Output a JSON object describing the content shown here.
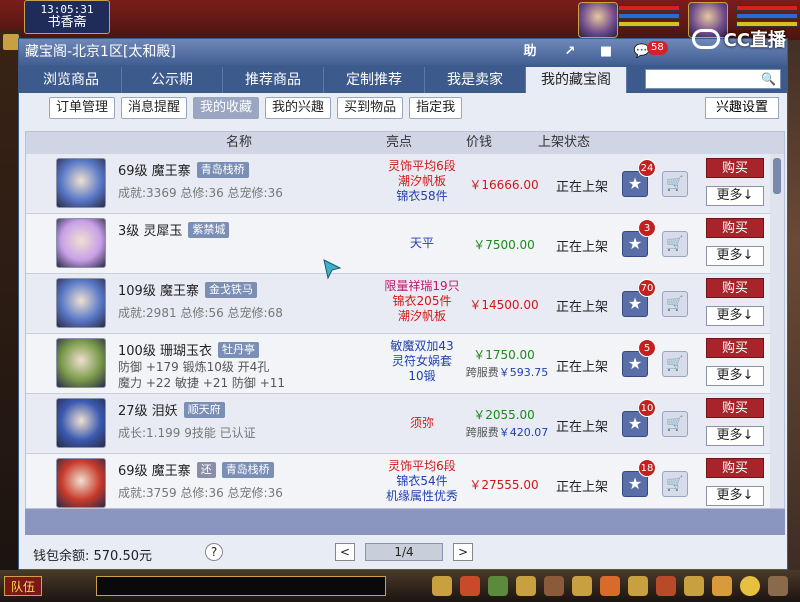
{
  "hud": {
    "clock": "13:05:31",
    "location": "书香斋",
    "stream_brand": "CC直播",
    "team_label": "队伍"
  },
  "window": {
    "title": "藏宝阁-北京1区[太和殿]",
    "title_buttons": [
      "助",
      "↗",
      "■",
      "💬"
    ],
    "notify_count": "58"
  },
  "tabs": [
    {
      "label": "浏览商品"
    },
    {
      "label": "公示期"
    },
    {
      "label": "推荐商品"
    },
    {
      "label": "定制推荐"
    },
    {
      "label": "我是卖家"
    },
    {
      "label": "我的藏宝阁"
    }
  ],
  "search": {
    "placeholder": ""
  },
  "subtabs": [
    {
      "label": "订单管理"
    },
    {
      "label": "消息提醒"
    },
    {
      "label": "我的收藏"
    },
    {
      "label": "我的兴趣"
    },
    {
      "label": "买到物品"
    },
    {
      "label": "指定我"
    }
  ],
  "interest_settings": "兴趣设置",
  "table": {
    "headers": [
      "名称",
      "亮点",
      "价钱",
      "上架状态"
    ],
    "rows": [
      {
        "level_name": "69级  魔王寨",
        "tag": "青岛栈桥",
        "tag2": "",
        "line2": "成就:3369 总修:36 总宠修:36",
        "line3": "",
        "highlights": [
          "灵饰平均6段",
          "潮汐帆板",
          "锦衣58件"
        ],
        "highlight_colors": [
          "#d01818",
          "#d01818",
          "#2040b0"
        ],
        "price": "￥16666.00",
        "price_color": "red",
        "cross": "",
        "cross_val": "",
        "status": "正在上架",
        "fav_count": "24",
        "buy": "购买",
        "more": "更多↓"
      },
      {
        "level_name": "3级  灵犀玉",
        "tag": "紫禁城",
        "tag2": "",
        "line2": "",
        "line3": "",
        "highlights": [
          "天平"
        ],
        "highlight_colors": [
          "#2040b0"
        ],
        "price": "￥7500.00",
        "price_color": "green",
        "cross": "",
        "cross_val": "",
        "status": "正在上架",
        "fav_count": "3",
        "buy": "购买",
        "more": "更多↓"
      },
      {
        "level_name": "109级  魔王寨",
        "tag": "金戈铁马",
        "tag2": "",
        "line2": "成就:2981 总修:56 总宠修:68",
        "line3": "",
        "highlights": [
          "限量祥瑞19只",
          "锦衣205件",
          "潮汐帆板"
        ],
        "highlight_colors": [
          "#c0186a",
          "#d01818",
          "#d01818"
        ],
        "price": "￥14500.00",
        "price_color": "red",
        "cross": "",
        "cross_val": "",
        "status": "正在上架",
        "fav_count": "70",
        "buy": "购买",
        "more": "更多↓"
      },
      {
        "level_name": "100级  珊瑚玉衣",
        "tag": "牡丹亭",
        "tag2": "",
        "line2": "防御 +179 锻炼10级 开4孔",
        "line3": "魔力 +22  敏捷 +21  防御 +11",
        "highlights": [
          "敏魔双加43",
          "灵符女娲套",
          "10锻"
        ],
        "highlight_colors": [
          "#2040b0",
          "#2040b0",
          "#2040b0"
        ],
        "price": "￥1750.00",
        "price_color": "green",
        "cross": "跨服费",
        "cross_val": "￥593.75",
        "status": "正在上架",
        "fav_count": "5",
        "buy": "购买",
        "more": "更多↓"
      },
      {
        "level_name": "27级  泪妖",
        "tag": "顺天府",
        "tag2": "",
        "line2": "成长:1.199 9技能 已认证",
        "line3": "",
        "highlights": [
          "须弥"
        ],
        "highlight_colors": [
          "#d01818"
        ],
        "price": "￥2055.00",
        "price_color": "green",
        "cross": "跨服费",
        "cross_val": "￥420.07",
        "status": "正在上架",
        "fav_count": "10",
        "buy": "购买",
        "more": "更多↓"
      },
      {
        "level_name": "69级  魔王寨",
        "tag": "青岛栈桥",
        "tag2": "还",
        "line2": "成就:3759 总修:36 总宠修:36",
        "line3": "",
        "highlights": [
          "灵饰平均6段",
          "锦衣54件",
          "机缘属性优秀"
        ],
        "highlight_colors": [
          "#d01818",
          "#2040b0",
          "#2040b0"
        ],
        "price": "￥27555.00",
        "price_color": "red",
        "cross": "",
        "cross_val": "",
        "status": "正在上架",
        "fav_count": "18",
        "buy": "购买",
        "more": "更多↓"
      }
    ]
  },
  "wallet": "钱包余额: 570.50元",
  "help": "?",
  "pager": {
    "prev": "<",
    "page": "1/4",
    "next": ">"
  },
  "avatar_colors": [
    "#5a7ac8",
    "#c8a0e8",
    "#5a7ac8",
    "#7a9a4a",
    "#3a5ab0",
    "#c83a2a"
  ]
}
